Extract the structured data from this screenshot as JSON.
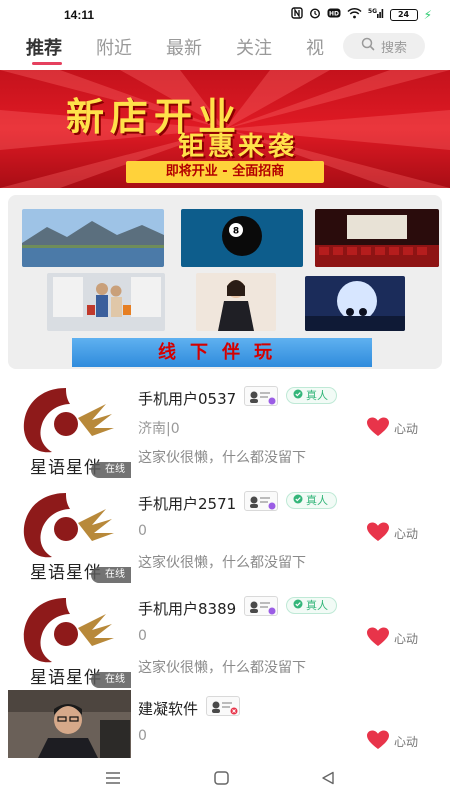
{
  "status": {
    "time": "14:11",
    "battery": "24",
    "icons": [
      "nfc-icon",
      "alarm-icon",
      "hd-icon",
      "wifi-icon",
      "signal-5g-icon",
      "battery-icon",
      "charging-icon"
    ]
  },
  "tabs": [
    {
      "label": "推荐",
      "active": true
    },
    {
      "label": "附近",
      "active": false
    },
    {
      "label": "最新",
      "active": false
    },
    {
      "label": "关注",
      "active": false
    },
    {
      "label": "视",
      "active": false
    }
  ],
  "search": {
    "placeholder": "搜索"
  },
  "banner": {
    "title_line1": "新店开业",
    "title_line2": "钜惠来袭",
    "subtitle": "即将开业 - 全面招商"
  },
  "offline": {
    "label": "线下伴玩"
  },
  "users": [
    {
      "name": "手机用户0537",
      "verified_label": "真人",
      "location": "济南|0",
      "bio": "这家伙很懒，什么都没留下",
      "like_label": "心动",
      "brand": "星语星伴",
      "online_label": "在线",
      "verified": true
    },
    {
      "name": "手机用户2571",
      "verified_label": "真人",
      "location": "0",
      "bio": "这家伙很懒，什么都没留下",
      "like_label": "心动",
      "brand": "星语星伴",
      "online_label": "在线",
      "verified": true
    },
    {
      "name": "手机用户8389",
      "verified_label": "真人",
      "location": "0",
      "bio": "这家伙很懒，什么都没留下",
      "like_label": "心动",
      "brand": "星语星伴",
      "online_label": "在线",
      "verified": true
    },
    {
      "name": "建凝软件",
      "verified_label": "",
      "location": "0",
      "bio": "",
      "like_label": "心动",
      "brand": "",
      "online_label": "",
      "verified": false
    }
  ],
  "colors": {
    "accent": "#e5405e",
    "heart": "#e8344a",
    "verified_green": "#34b67a"
  }
}
